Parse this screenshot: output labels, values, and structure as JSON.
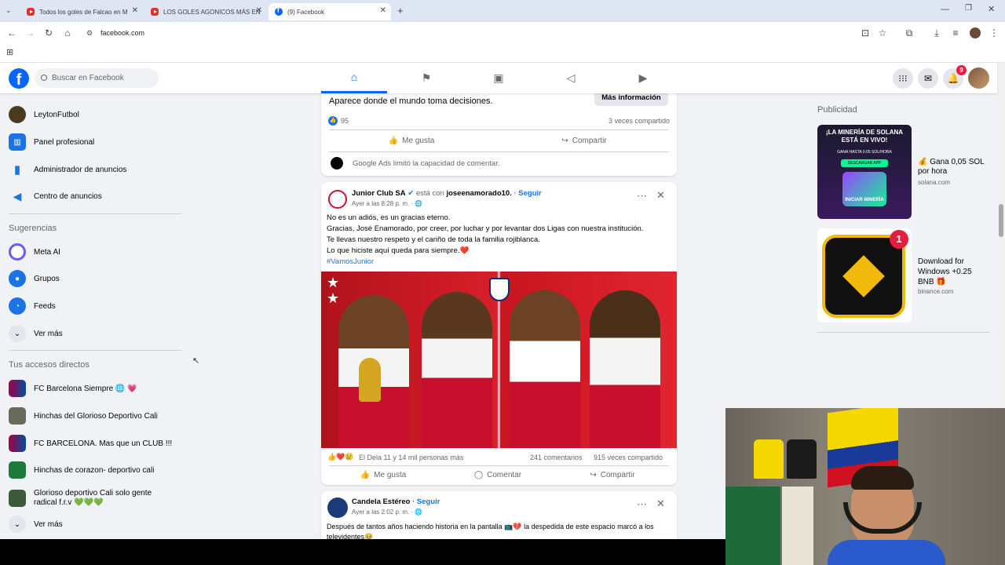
{
  "browser": {
    "tabs": [
      {
        "title": "Todos los goles de Falcao en M"
      },
      {
        "title": "LOS GOLES AGONICOS MÁS EN"
      },
      {
        "title": "(9) Facebook"
      }
    ],
    "url": "facebook.com"
  },
  "header": {
    "search_placeholder": "Buscar en Facebook",
    "notif_count": "9"
  },
  "left_top": [
    {
      "label": "LeytonFutbol"
    },
    {
      "label": "Panel profesional"
    },
    {
      "label": "Administrador de anuncios"
    },
    {
      "label": "Centro de anuncios"
    }
  ],
  "suggestions": {
    "title": "Sugerencias",
    "items": [
      {
        "label": "Meta AI"
      },
      {
        "label": "Grupos"
      },
      {
        "label": "Feeds"
      },
      {
        "label": "Ver más"
      }
    ]
  },
  "shortcuts": {
    "title": "Tus accesos directos",
    "items": [
      {
        "label": "FC Barcelona Siempre 🌐 💗"
      },
      {
        "label": "Hinchas del Glorioso Deportivo Cali"
      },
      {
        "label": "FC BARCELONA. Mas que un CLUB !!!"
      },
      {
        "label": "Hinchas de corazon- deportivo cali"
      },
      {
        "label": "Glorioso deportivo Cali solo gente radical f.r.v 💚💚💚"
      },
      {
        "label": "Ver más"
      }
    ]
  },
  "post1": {
    "text": "Aparece donde el mundo toma decisiones.",
    "button": "Más información",
    "likes": "95",
    "shares": "3 veces compartido",
    "like_label": "Me gusta",
    "share_label": "Compartir",
    "comments_note": "Google Ads limitó la capacidad de comentar."
  },
  "post2": {
    "author": "Junior Club SA",
    "with": "está con",
    "tagged": "joseenamorado10.",
    "follow": "· Seguir",
    "time": "Ayer a las 8:28 p. m. ·",
    "lines": [
      "No es un adiós, es un gracias eterno.",
      "Gracias, José Enamorado, por creer, por luchar y por levantar dos Ligas con nuestra institución.",
      "Te llevas nuestro respeto y el cariño de toda la familia rojiblanca.",
      "Lo que hiciste aquí queda para siempre.❤️"
    ],
    "hashtag": "#VamosJunior",
    "reactions": "El Dela 11 y 14 mil personas más",
    "comments": "241 comentarios",
    "shares": "915 veces compartido",
    "like_label": "Me gusta",
    "comment_label": "Comentar",
    "share_label": "Compartir"
  },
  "post3": {
    "author": "Candela Estéreo",
    "follow": "· Seguir",
    "time": "Ayer a las 2:02 p. m. ·",
    "text": "Después de tantos años haciendo historia en la pantalla 📺💔 la despedida de este espacio marcó a los televidentes🥹"
  },
  "ads": {
    "title": "Publicidad",
    "items": [
      {
        "title": "💰 Gana 0,05 SOL por hora",
        "domain": "solana.com",
        "img_text": "¡LA MINERÍA DE SOLANA ESTÁ EN VIVO!",
        "img_sub": "GANA HASTA 0.05 SOL/HORA",
        "img_btn": "DESCARGAR APP",
        "img_foot": "INICIAR MINERÍA"
      },
      {
        "title": "Download for Windows +0.25 BNB 🎁",
        "domain": "binance.com",
        "badge": "1"
      }
    ]
  }
}
